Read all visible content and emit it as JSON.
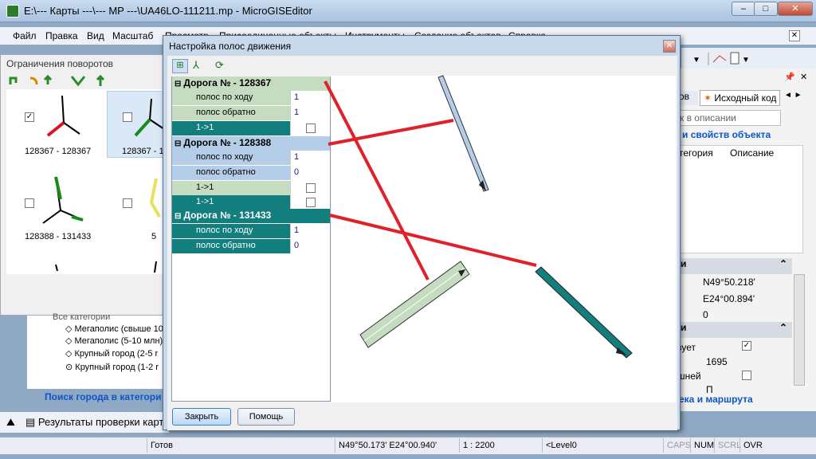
{
  "app": {
    "title": "E:\\--- Карты ---\\--- MP ---\\UA46LO-111211.mp - MicroGISEditor"
  },
  "window_buttons": {
    "minimize": "–",
    "maximize": "□",
    "close": "✕"
  },
  "menu": [
    "Файл",
    "Правка",
    "Вид",
    "Масштаб",
    "Просмотр",
    "Присоединенные объекты",
    "Инструменты",
    "Создание объектов",
    "Справка"
  ],
  "menu_close": "✕",
  "left_panel": {
    "title": "Ограничения поворотов",
    "cells": [
      {
        "label": "128367 - 128367",
        "checked": true
      },
      {
        "label": "128367 - 1",
        "checked": false
      },
      {
        "label": "128388 - 131433",
        "checked": false
      },
      {
        "label": "5",
        "checked": false
      }
    ]
  },
  "tree": {
    "root": "Все категории",
    "items": [
      "Мегаполис (свыше 10",
      "Мегаполис (5-10 млн)",
      "Крупный город (2-5 r",
      "Крупный город (1-2 r"
    ]
  },
  "search_city": "Поиск города в категори",
  "results_tab": "Результаты проверки карты",
  "right_panel": {
    "tab_left": "ов",
    "tab_right": "Исходный код",
    "search_placeholder": "к в описании",
    "link1": "и свойств объекта",
    "col_category": "тегория",
    "col_description": "Описание",
    "section1": "и",
    "lat": "N49°50.218'",
    "lon": "E24°00.894'",
    "zero": "0",
    "section2": "и",
    "uses_label": "зует",
    "number": "1695",
    "ext_label": "шней",
    "link2": "ека и маршрута",
    "cut_text": "П"
  },
  "dialog": {
    "title": "Настройка полос движения",
    "close": "✕",
    "roads": [
      {
        "header": "Дорога № - 128367",
        "rows": [
          {
            "label": "полос по ходу",
            "value": "1"
          },
          {
            "label": "полос обратно",
            "value": "1"
          }
        ],
        "links": [
          "1->1"
        ]
      },
      {
        "header": "Дорога № - 128388",
        "rows": [
          {
            "label": "полос по ходу",
            "value": "1"
          },
          {
            "label": "полос обратно",
            "value": "0"
          }
        ],
        "links": [
          "1->1",
          "1->1"
        ]
      },
      {
        "header": "Дорога № - 131433",
        "rows": [
          {
            "label": "полос по ходу",
            "value": "1"
          },
          {
            "label": "полос обратно",
            "value": "0"
          }
        ],
        "links": []
      }
    ],
    "buttons": {
      "close": "Закрыть",
      "help": "Помощь"
    }
  },
  "status": {
    "ready": "Готов",
    "coords": "N49°50.173' E24°00.940'",
    "scale": "1 : 2200",
    "level": "<Level0",
    "caps": "CAPS",
    "num": "NUM",
    "scrl": "SCRL",
    "ovr": "OVR"
  },
  "colors": {
    "road1": "#c5dcc0",
    "road2": "#b4cde9",
    "road3": "#137e7e",
    "link_red": "#e0202a"
  }
}
